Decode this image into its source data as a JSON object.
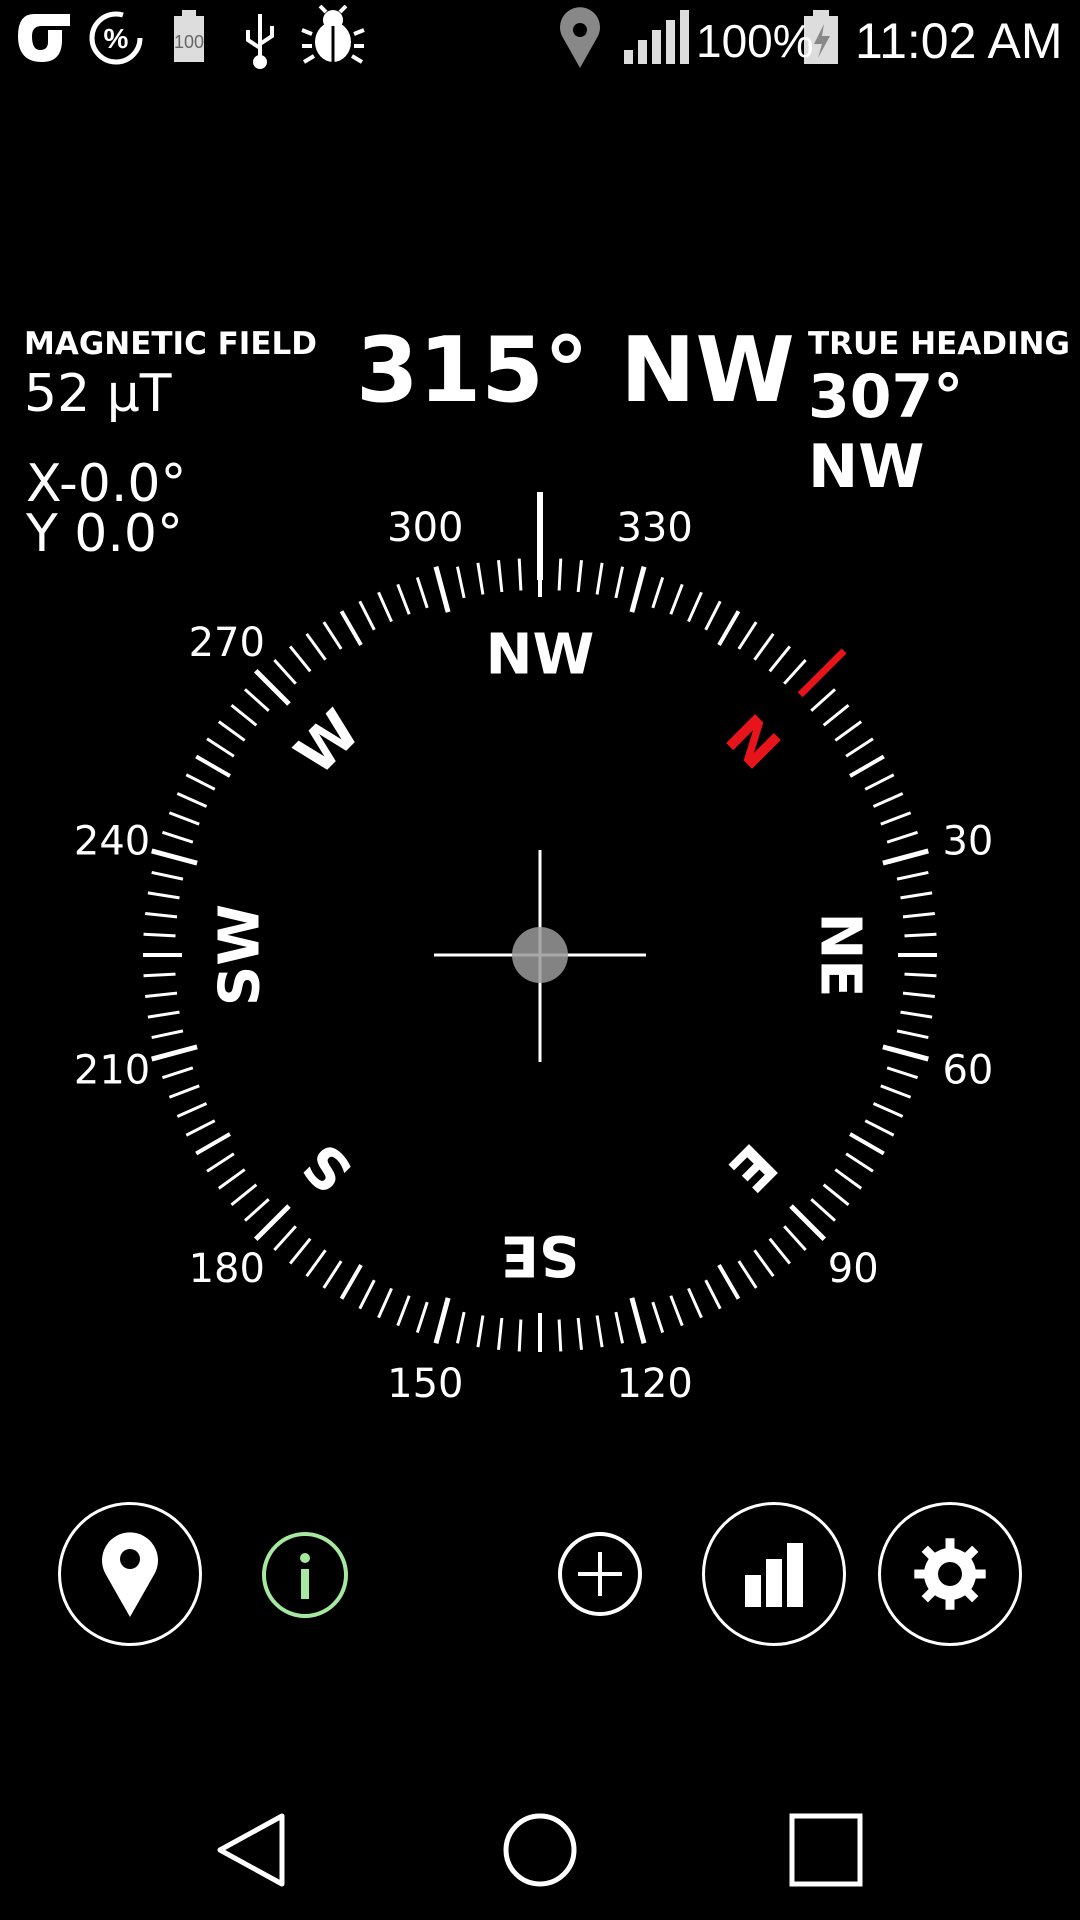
{
  "status_bar": {
    "icons": [
      "app-logo-icon",
      "percent-circle-icon",
      "battery-100-icon",
      "usb-icon",
      "debug-bug-icon",
      "location-pin-icon",
      "signal-bars-icon",
      "battery-charging-icon"
    ],
    "battery_percent": "100%",
    "time": "11:02 AM"
  },
  "readouts": {
    "magnetic_field_label": "MAGNETIC FIELD",
    "magnetic_field_value": "52 μT",
    "heading": "315° NW",
    "true_heading_label": "TRUE HEADING",
    "true_heading_value": "307° NW",
    "tilt_x": "X-0.0°",
    "tilt_y": "Y  0.0°"
  },
  "compass": {
    "heading_degrees": 315,
    "degree_labels": [
      "300",
      "330",
      "30",
      "60",
      "90",
      "120",
      "150",
      "180",
      "210",
      "240",
      "270"
    ],
    "direction_labels": [
      "NW",
      "NE",
      "E",
      "SE",
      "S",
      "SW",
      "W"
    ],
    "north_label": "N",
    "north_color": "#e8141b"
  },
  "toolbar": {
    "buttons": [
      "location-pin-icon",
      "info-icon",
      "add-icon",
      "bar-chart-icon",
      "gear-icon"
    ],
    "info_color": "#a6e8a0"
  },
  "nav_bar": {
    "buttons": [
      "back-icon",
      "home-icon",
      "recents-icon"
    ]
  }
}
